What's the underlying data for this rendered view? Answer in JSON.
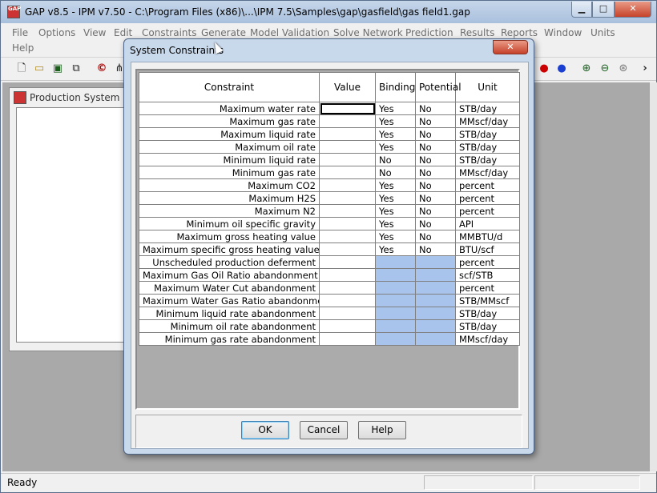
{
  "window": {
    "title": "GAP v8.5 - IPM v7.50 - C:\\Program Files (x86)\\...\\IPM 7.5\\Samples\\gap\\gasfield\\gas field1.gap",
    "app_icon_text": "GAP"
  },
  "menu": {
    "row1": [
      "File",
      "Options",
      "View",
      "Edit",
      "Constraints",
      "Generate",
      "Model Validation",
      "Solve Network",
      "Prediction",
      "Results",
      "Reports",
      "Window",
      "Units"
    ],
    "row2": [
      "Help"
    ]
  },
  "toolbar": {
    "icons": [
      "new-file-icon",
      "open-folder-icon",
      "save-icon",
      "copy-window-icon",
      "copyright-icon",
      "network-icon",
      "colors-icon",
      "blue-circle-icon",
      "zoom-in-icon",
      "zoom-out-icon",
      "zoom-reset-icon",
      "chevron-right-icon"
    ]
  },
  "child_window": {
    "title": "Production System"
  },
  "status": {
    "text": "Ready"
  },
  "dialog": {
    "title": "System Constraints",
    "columns": [
      "Constraint",
      "Value",
      "Binding",
      "Potential",
      "Unit"
    ],
    "rows": [
      {
        "constraint": "Maximum water rate",
        "value": "",
        "binding": "Yes",
        "potential": "No",
        "unit": "STB/day"
      },
      {
        "constraint": "Maximum gas rate",
        "value": "",
        "binding": "Yes",
        "potential": "No",
        "unit": "MMscf/day"
      },
      {
        "constraint": "Maximum liquid rate",
        "value": "",
        "binding": "Yes",
        "potential": "No",
        "unit": "STB/day"
      },
      {
        "constraint": "Maximum oil rate",
        "value": "",
        "binding": "Yes",
        "potential": "No",
        "unit": "STB/day"
      },
      {
        "constraint": "Minimum liquid rate",
        "value": "",
        "binding": "No",
        "potential": "No",
        "unit": "STB/day"
      },
      {
        "constraint": "Minimum gas rate",
        "value": "",
        "binding": "No",
        "potential": "No",
        "unit": "MMscf/day"
      },
      {
        "constraint": "Maximum CO2",
        "value": "",
        "binding": "Yes",
        "potential": "No",
        "unit": "percent"
      },
      {
        "constraint": "Maximum H2S",
        "value": "",
        "binding": "Yes",
        "potential": "No",
        "unit": "percent"
      },
      {
        "constraint": "Maximum N2",
        "value": "",
        "binding": "Yes",
        "potential": "No",
        "unit": "percent"
      },
      {
        "constraint": "Minimum oil specific gravity",
        "value": "",
        "binding": "Yes",
        "potential": "No",
        "unit": "API"
      },
      {
        "constraint": "Maximum gross heating value",
        "value": "",
        "binding": "Yes",
        "potential": "No",
        "unit": "MMBTU/d"
      },
      {
        "constraint": "Maximum specific gross heating value",
        "value": "",
        "binding": "Yes",
        "potential": "No",
        "unit": "BTU/scf"
      },
      {
        "constraint": "Unscheduled production deferment",
        "value": "",
        "binding": null,
        "potential": null,
        "unit": "percent"
      },
      {
        "constraint": "Maximum Gas Oil Ratio abandonment",
        "value": "",
        "binding": null,
        "potential": null,
        "unit": "scf/STB"
      },
      {
        "constraint": "Maximum Water Cut abandonment",
        "value": "",
        "binding": null,
        "potential": null,
        "unit": "percent"
      },
      {
        "constraint": "Maximum Water Gas Ratio abandonment",
        "value": "",
        "binding": null,
        "potential": null,
        "unit": "STB/MMscf"
      },
      {
        "constraint": "Minimum liquid rate abandonment",
        "value": "",
        "binding": null,
        "potential": null,
        "unit": "STB/day"
      },
      {
        "constraint": "Minimum oil rate abandonment",
        "value": "",
        "binding": null,
        "potential": null,
        "unit": "STB/day"
      },
      {
        "constraint": "Minimum gas rate abandonment",
        "value": "",
        "binding": null,
        "potential": null,
        "unit": "MMscf/day"
      }
    ],
    "buttons": {
      "ok": "OK",
      "cancel": "Cancel",
      "help": "Help"
    },
    "disabled_cell_color": "#a8c4ec"
  }
}
